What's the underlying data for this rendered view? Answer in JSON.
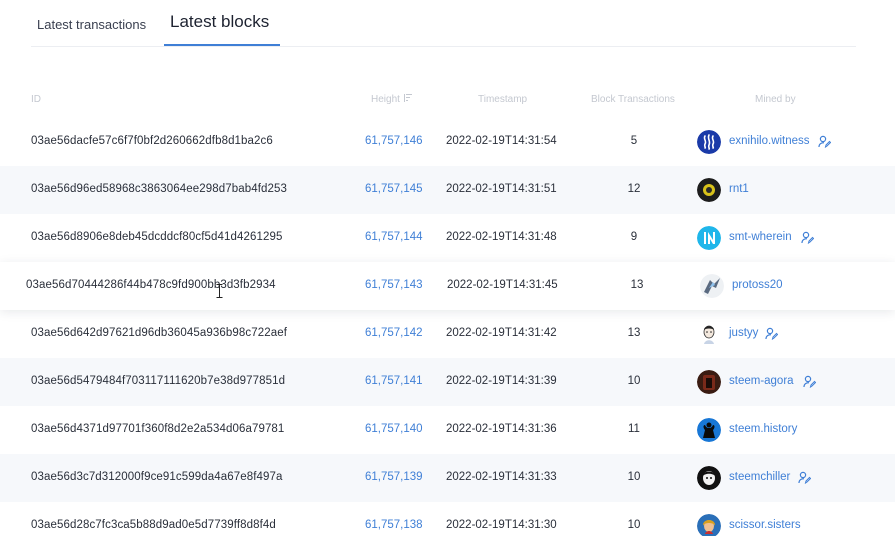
{
  "tabs": {
    "transactions_label": "Latest transactions",
    "blocks_label": "Latest blocks",
    "active": "blocks"
  },
  "table": {
    "headers": {
      "id": "ID",
      "height": "Height",
      "timestamp": "Timestamp",
      "block_transactions": "Block Transactions",
      "mined_by": "Mined by"
    },
    "rows": [
      {
        "id": "03ae56dacfe57c6f7f0bf2d260662dfb8d1ba2c6",
        "height": "61,757,146",
        "timestamp": "2022-02-19T14:31:54",
        "transactions": "5",
        "miner": "exnihilo.witness",
        "avatar_icon": "steem-logo-icon",
        "witness_icon": true
      },
      {
        "id": "03ae56d96ed58968c3863064ee298d7bab4fd253",
        "height": "61,757,145",
        "timestamp": "2022-02-19T14:31:51",
        "transactions": "12",
        "miner": "rnt1",
        "avatar_icon": "rnt1-avatar",
        "witness_icon": false
      },
      {
        "id": "03ae56d8906e8deb45dcddcf80cf5d41d4261295",
        "height": "61,757,144",
        "timestamp": "2022-02-19T14:31:48",
        "transactions": "9",
        "miner": "smt-wherein",
        "avatar_icon": "smt-logo-icon",
        "witness_icon": true
      },
      {
        "id": "03ae56d70444286f44b478c9fd900bb3d3fb2934",
        "height": "61,757,143",
        "timestamp": "2022-02-19T14:31:45",
        "transactions": "13",
        "miner": "protoss20",
        "avatar_icon": "protoss-avatar",
        "witness_icon": false
      },
      {
        "id": "03ae56d642d97621d96db36045a936b98c722aef",
        "height": "61,757,142",
        "timestamp": "2022-02-19T14:31:42",
        "transactions": "13",
        "miner": "justyy",
        "avatar_icon": "justyy-avatar",
        "witness_icon": true
      },
      {
        "id": "03ae56d5479484f703117111620b7e38d977851d",
        "height": "61,757,141",
        "timestamp": "2022-02-19T14:31:39",
        "transactions": "10",
        "miner": "steem-agora",
        "avatar_icon": "steem-agora-avatar",
        "witness_icon": true
      },
      {
        "id": "03ae56d4371d97701f360f8d2e2a534d06a79781",
        "height": "61,757,140",
        "timestamp": "2022-02-19T14:31:36",
        "transactions": "11",
        "miner": "steem.history",
        "avatar_icon": "steem-history-avatar",
        "witness_icon": false
      },
      {
        "id": "03ae56d3c7d312000f9ce91c599da4a67e8f497a",
        "height": "61,757,139",
        "timestamp": "2022-02-19T14:31:33",
        "transactions": "10",
        "miner": "steemchiller",
        "avatar_icon": "steemchiller-avatar",
        "witness_icon": true
      },
      {
        "id": "03ae56d28c7fc3ca5b88d9ad0e5d7739ff8d8f4d",
        "height": "61,757,138",
        "timestamp": "2022-02-19T14:31:30",
        "transactions": "10",
        "miner": "scissor.sisters",
        "avatar_icon": "scissor-sisters-avatar",
        "witness_icon": false
      }
    ]
  },
  "colors": {
    "accent": "#3f7fd6",
    "header_text": "#c4c8d0",
    "row_alt": "#f6f8fb"
  }
}
